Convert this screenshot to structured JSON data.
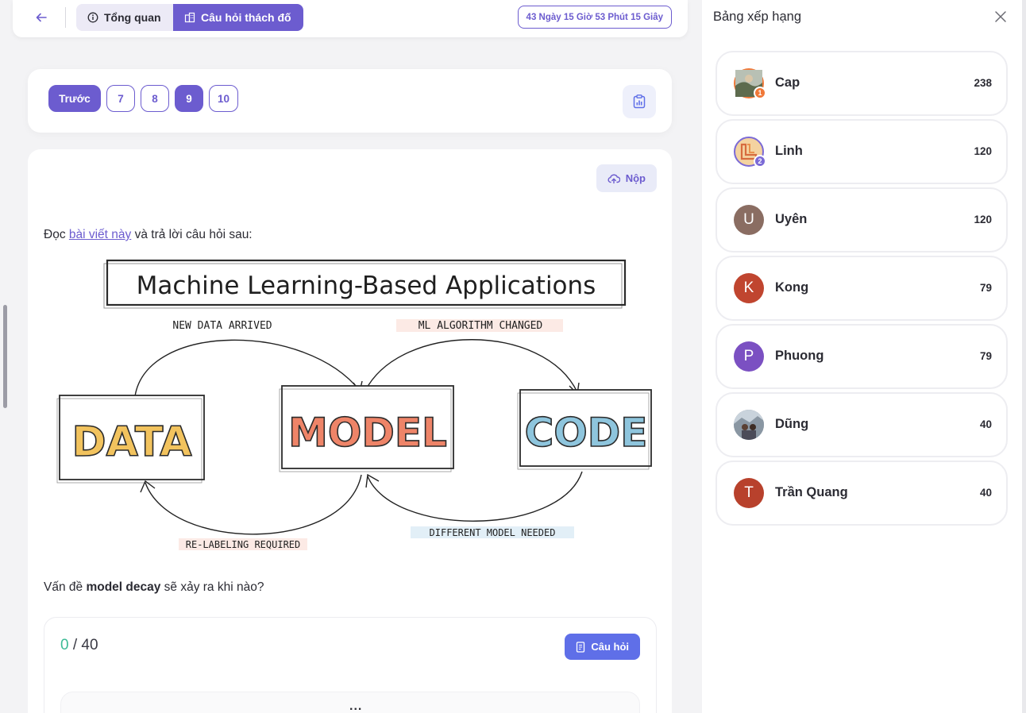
{
  "nav": {
    "overview_label": "Tổng quan",
    "challenge_label": "Câu hỏi thách đố",
    "timer": "43 Ngày 15 Giờ 53 Phút 15 Giây"
  },
  "pager": {
    "prev_label": "Trước",
    "pages": [
      "7",
      "8",
      "9",
      "10"
    ],
    "active_page": "9"
  },
  "question": {
    "submit_label": "Nộp",
    "intro_prefix": "Đọc ",
    "intro_link": "bài viết này",
    "intro_suffix": " và trả lời câu hỏi sau:",
    "text_prefix": "Vấn đề ",
    "text_bold": "model decay",
    "text_suffix": " sẽ xảy ra khi nào?",
    "score_current": "0",
    "score_total": "/ 40",
    "questions_button": "Câu hỏi",
    "more": "..."
  },
  "diagram": {
    "title": "Machine Learning-Based Applications",
    "boxes": [
      "DATA",
      "MODEL",
      "CODE"
    ],
    "arrow_labels": [
      "NEW DATA ARRIVED",
      "ML ALGORITHM CHANGED",
      "RE-LABELING REQUIRED",
      "DIFFERENT MODEL NEEDED"
    ],
    "colors": {
      "data": "#f2c35e",
      "model": "#ee8468",
      "code": "#8ec5dd"
    }
  },
  "leaderboard": {
    "title": "Bảng xếp hạng",
    "entries": [
      {
        "name": "Cap",
        "score": "238",
        "avatar": "",
        "rank": "1",
        "color": "#6b7b5c",
        "badge": "#f07838"
      },
      {
        "name": "Linh",
        "score": "120",
        "avatar": "",
        "rank": "2",
        "color": "#f4d3a0",
        "badge": "#7b6ad6"
      },
      {
        "name": "Uyên",
        "score": "120",
        "avatar": "U",
        "rank": "",
        "color": "#8a6d62",
        "badge": ""
      },
      {
        "name": "Kong",
        "score": "79",
        "avatar": "K",
        "rank": "",
        "color": "#c0452f",
        "badge": ""
      },
      {
        "name": "Phuong",
        "score": "79",
        "avatar": "P",
        "rank": "",
        "color": "#7b50c2",
        "badge": ""
      },
      {
        "name": "Dũng",
        "score": "40",
        "avatar": "",
        "rank": "",
        "color": "#7a8795",
        "badge": ""
      },
      {
        "name": "Trần Quang",
        "score": "40",
        "avatar": "T",
        "rank": "",
        "color": "#b8412c",
        "badge": ""
      }
    ]
  },
  "theme": {
    "accent": "#6c5ccf",
    "button_blue": "#5f6fe8",
    "score_green": "#3dbb96"
  }
}
